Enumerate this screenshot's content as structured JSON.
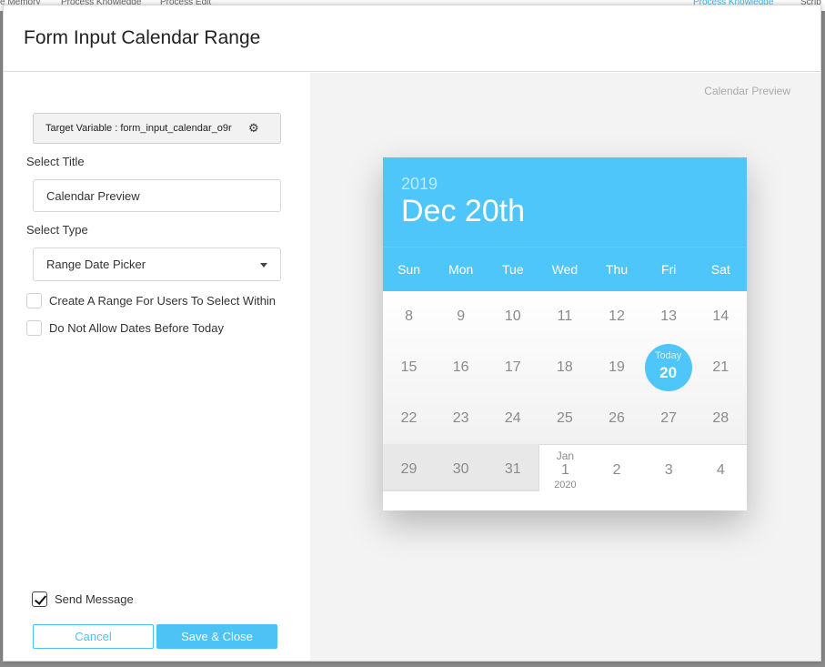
{
  "background": {
    "items": [
      "e Memory",
      "Process Knowledge",
      "Process Edit"
    ],
    "right_link": "Process Knowledge",
    "right_item": "Scrip"
  },
  "modal": {
    "title": "Form Input Calendar Range"
  },
  "form": {
    "target_variable": "Target Variable : form_input_calendar_o9r",
    "select_title_label": "Select Title",
    "title_value": "Calendar Preview",
    "select_type_label": "Select Type",
    "type_value": "Range Date Picker",
    "checkbox_range_label": "Create A Range For Users To Select Within",
    "checkbox_range_checked": false,
    "checkbox_past_label": "Do Not Allow Dates Before Today",
    "checkbox_past_checked": false,
    "send_message_label": "Send Message",
    "send_message_checked": true,
    "cancel_label": "Cancel",
    "save_label": "Save & Close"
  },
  "preview": {
    "label": "Calendar Preview",
    "calendar": {
      "year": "2019",
      "date_heading": "Dec 20th",
      "weekdays": [
        "Sun",
        "Mon",
        "Tue",
        "Wed",
        "Thu",
        "Fri",
        "Sat"
      ],
      "weeks": [
        [
          "8",
          "9",
          "10",
          "11",
          "12",
          "13",
          "14"
        ],
        [
          "15",
          "16",
          "17",
          "18",
          "19",
          "20",
          "21"
        ],
        [
          "22",
          "23",
          "24",
          "25",
          "26",
          "27",
          "28"
        ],
        [
          "29",
          "30",
          "31",
          "1",
          "2",
          "3",
          "4"
        ]
      ],
      "today_caption": "Today",
      "today_day": "20",
      "next_month_label": "Jan",
      "next_month_year": "2020"
    }
  },
  "colors": {
    "accent": "#4fc6fa",
    "button_blue": "#4cc2f5"
  }
}
